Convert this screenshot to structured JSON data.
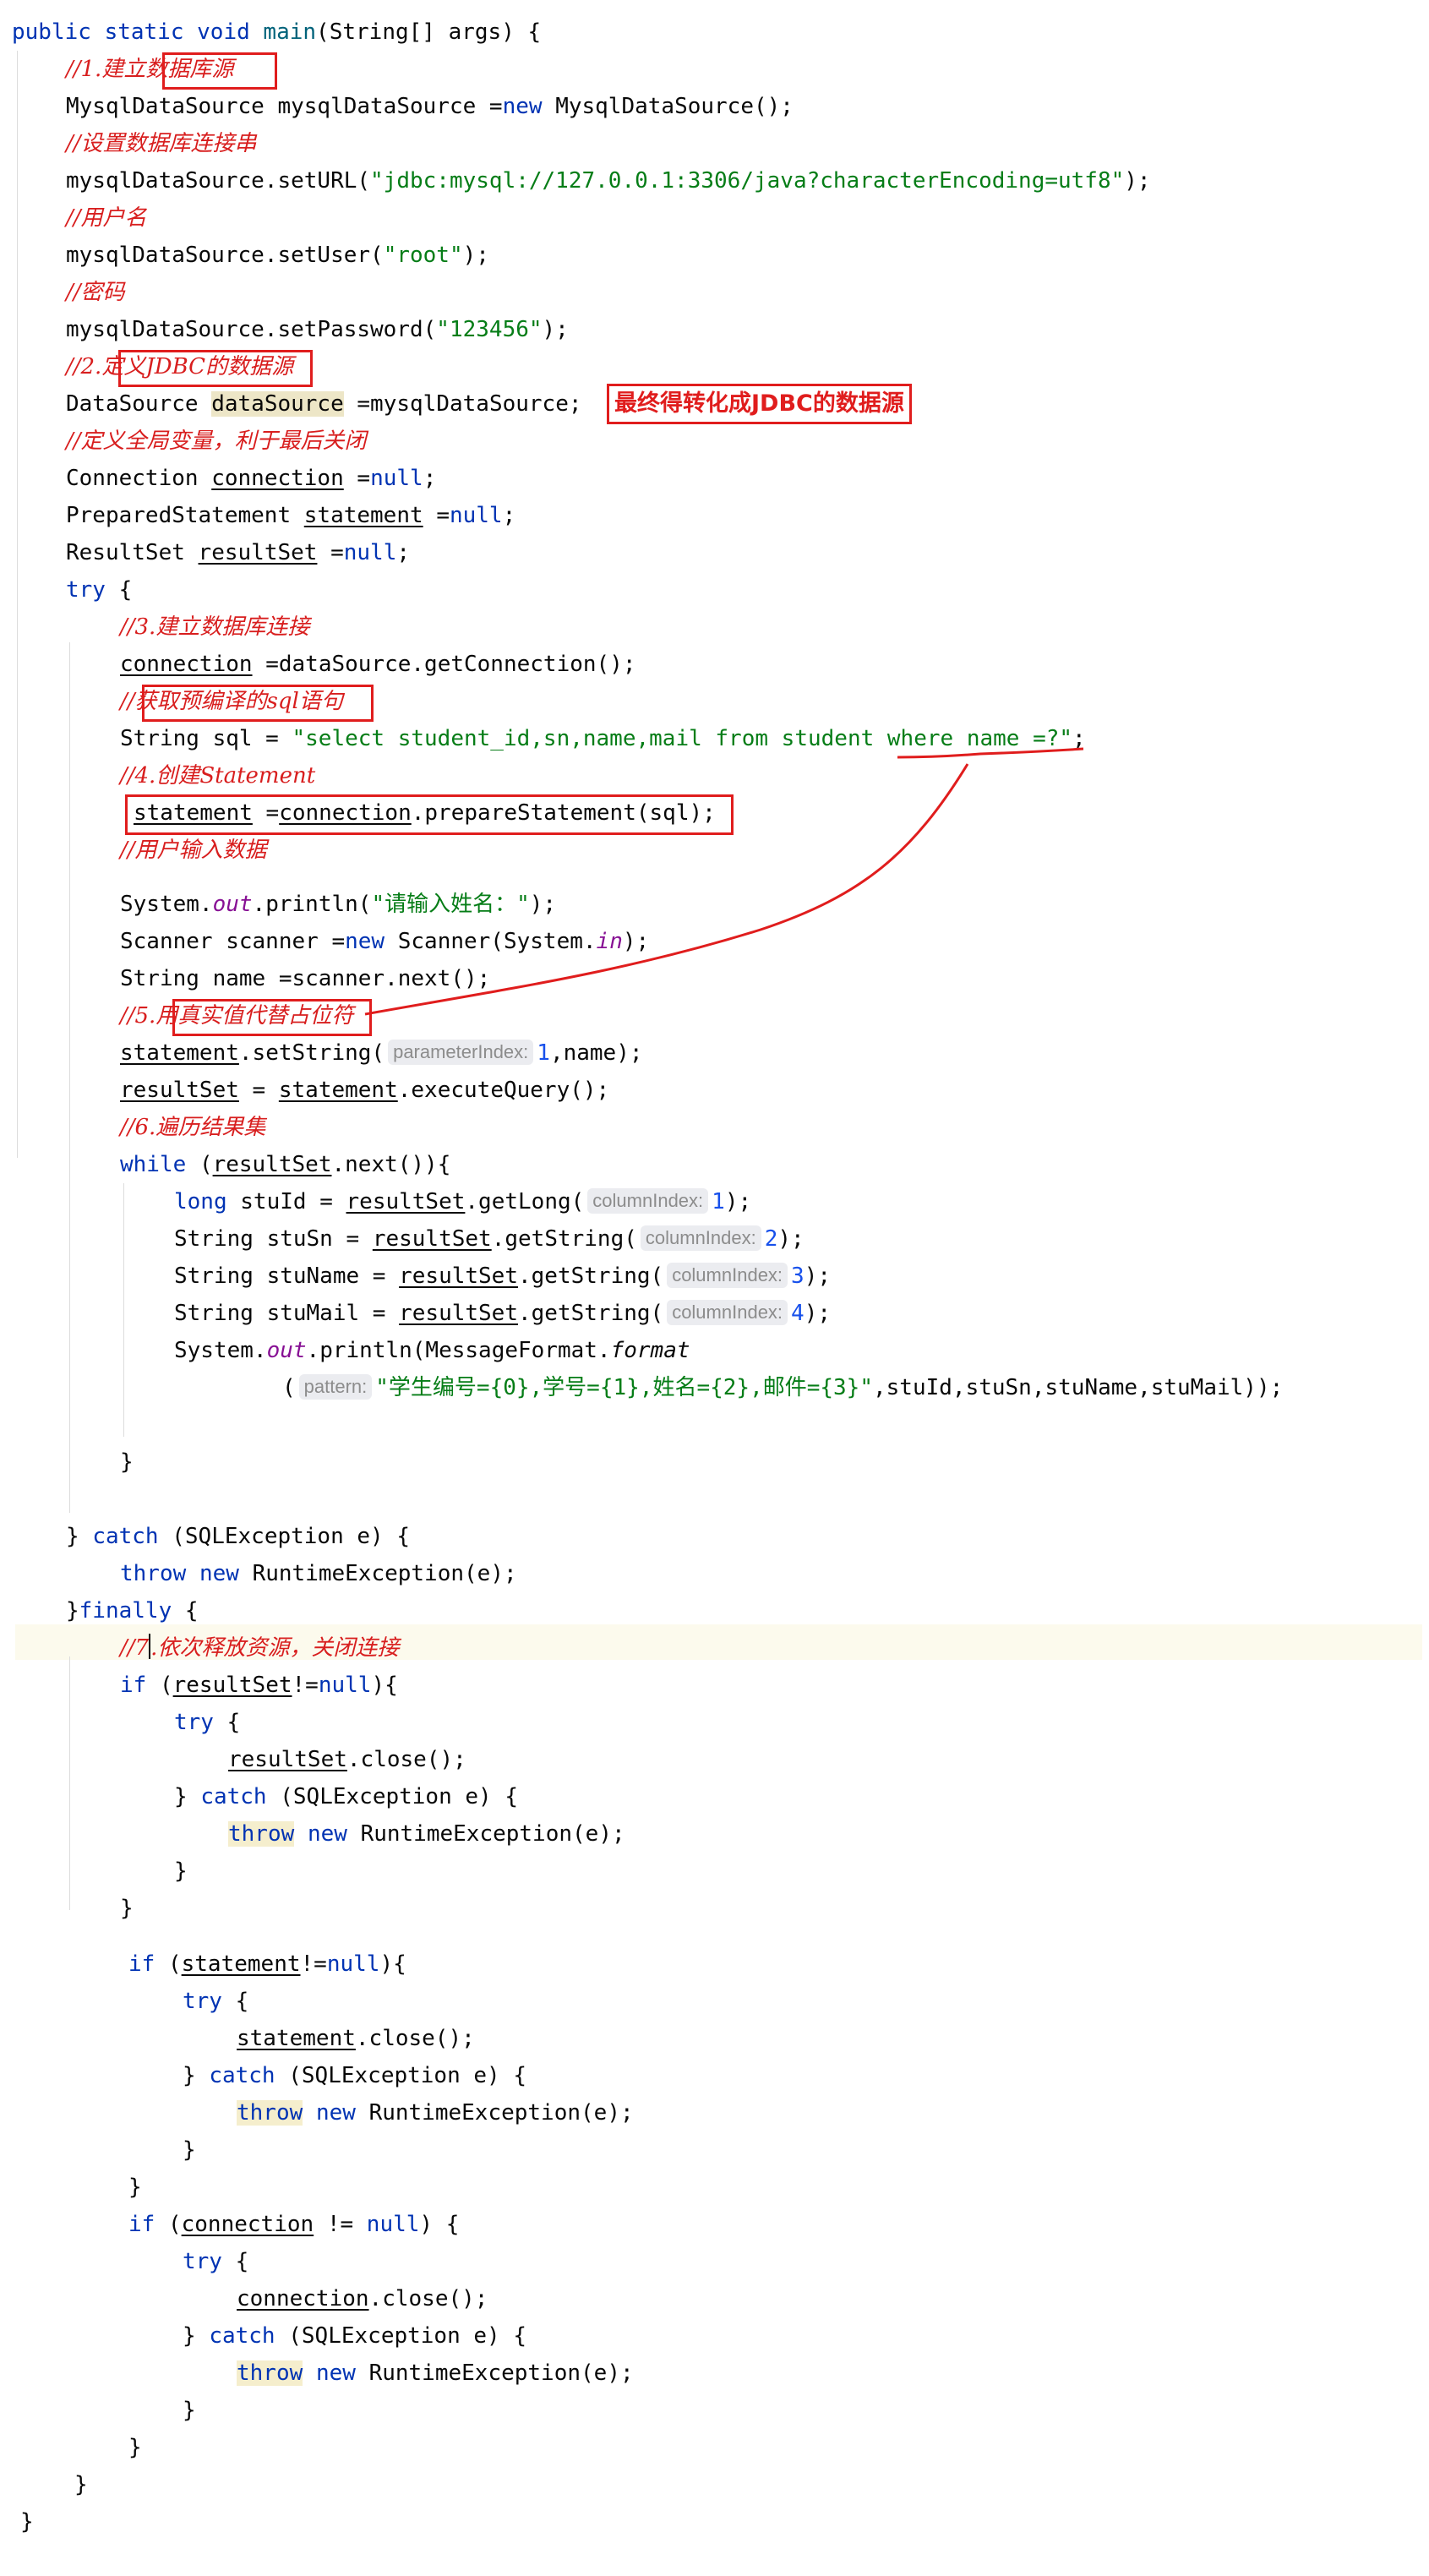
{
  "annotation": {
    "note": "最终得转化成JDBC的数据源"
  },
  "code": {
    "t1": "public static void",
    "t2": "main",
    "t3": "(String[] args) {",
    "t4": "//1.建立数据库源",
    "t5": "MysqlDataSource mysqlDataSource =",
    "t6": "new",
    "t7": "MysqlDataSource();",
    "t8": "//设置数据库连接串",
    "t9": "mysqlDataSource.setURL(",
    "t10": "\"jdbc:mysql://127.0.0.1:3306/java?characterEncoding=utf8\"",
    "t11": ");",
    "t12": "//用户名",
    "t13": "mysqlDataSource.setUser(",
    "t14": "\"root\"",
    "t15": ");",
    "t16": "//密码",
    "t17": "mysqlDataSource.setPassword(",
    "t18": "\"123456\"",
    "t19": ");",
    "t20": "//2.定义JDBC的数据源",
    "t21": "DataSource",
    "t22": "dataSource",
    "t23": "=mysqlDataSource;",
    "t24": "//定义全局变量，利于最后关闭",
    "t25": "Connection",
    "t26": "connection",
    "t27": "=",
    "t28": "null",
    "t29": ";",
    "t30": "PreparedStatement",
    "t31": "statement",
    "t32": "=",
    "t33": "null",
    "t34": ";",
    "t35": "ResultSet",
    "t36": "resultSet",
    "t37": "=",
    "t38": "null",
    "t39": ";",
    "t40": "try",
    "t41": "{",
    "t42": "//3.建立数据库连接",
    "t43": "connection",
    "t44": "=dataSource.getConnection();",
    "t45": "//获取预编译的sql语句",
    "t46": "String sql =",
    "t47": "\"select student_id,sn,name,mail from student where name =?\"",
    "t48": ";",
    "t49": "//4.创建Statement",
    "t50": "statement",
    "t51": "=",
    "t52": "connection",
    "t53": ".prepareStatement(sql);",
    "t54": "//用户输入数据",
    "t55": "System.",
    "t56": "out",
    "t57": ".println(",
    "t58": "\"请输入姓名：\"",
    "t59": ");",
    "t60": "Scanner scanner =",
    "t61": "new",
    "t62": "Scanner(System.",
    "t63": "in",
    "t64": ");",
    "t65": "String name =scanner.next();",
    "t66": "//5.用真实值代替占位符",
    "t67": "statement",
    "t68": ".setString(",
    "t69": "parameterIndex:",
    "t70": "1",
    "t71": ",name);",
    "t72": "resultSet",
    "t73": "=",
    "t74": "statement",
    "t75": ".executeQuery();",
    "t76": "//6.遍历结果集",
    "t77": "while",
    "t78": "(",
    "t79": "resultSet",
    "t80": ".next()){",
    "t81": "long",
    "t82": "stuId =",
    "t83": "resultSet",
    "t84": ".getLong(",
    "t85": "columnIndex:",
    "t86": "1",
    "t87": ");",
    "t88": "String stuSn =",
    "t89": "resultSet",
    "t90": ".getString(",
    "t91": "columnIndex:",
    "t92": "2",
    "t93": ");",
    "t94": "String stuName =",
    "t95": "resultSet",
    "t96": ".getString(",
    "t97": "columnIndex:",
    "t98": "3",
    "t99": ");",
    "t100": "String stuMail =",
    "t101": "resultSet",
    "t102": ".getString(",
    "t103": "columnIndex:",
    "t104": "4",
    "t105": ");",
    "t106": "System.",
    "t107": "out",
    "t108": ".println(MessageFormat.",
    "t109": "format",
    "t110": "(",
    "t111": "pattern:",
    "t112": "\"学生编号={0},学号={1},姓名={2},邮件={3}\"",
    "t113": ",stuId,stuSn,stuName,stuMail));",
    "t114": "}",
    "t115": "}",
    "t116": "catch",
    "t117": "(SQLException e) {",
    "t118": "throw",
    "t119": "new",
    "t120": "RuntimeException(e);",
    "t121": "}",
    "t122": "finally",
    "t123": "{",
    "t124": "//7",
    "t125": ".依次释放资源，关闭连接",
    "t126": "if",
    "t127": "(",
    "t128": "resultSet",
    "t129": "!=",
    "t130": "null",
    "t131": "){",
    "t132": "try",
    "t133": "{",
    "t134": "resultSet",
    "t135": ".close();",
    "t136": "}",
    "t137": "catch",
    "t138": "(SQLException e) {",
    "t139": "throw",
    "t140": "new",
    "t141": "RuntimeException(e);",
    "t142": "}",
    "t143": "}",
    "t144": "if",
    "t145": "(",
    "t146": "statement",
    "t147": "!=",
    "t148": "null",
    "t149": "){",
    "t150": "try",
    "t151": "{",
    "t152": "statement",
    "t153": ".close();",
    "t154": "}",
    "t155": "catch",
    "t156": "(SQLException e) {",
    "t157": "throw",
    "t158": "new",
    "t159": "RuntimeException(e);",
    "t160": "}",
    "t161": "}",
    "t162": "if",
    "t163": "(",
    "t164": "connection",
    "t165": "!=",
    "t166": "null",
    "t167": ") {",
    "t168": "try",
    "t169": "{",
    "t170": "connection",
    "t171": ".close();",
    "t172": "}",
    "t173": "catch",
    "t174": "(SQLException e) {",
    "t175": "throw",
    "t176": "new",
    "t177": "RuntimeException(e);",
    "t178": "}",
    "t179": "}",
    "t180": "}",
    "t181": "}"
  }
}
